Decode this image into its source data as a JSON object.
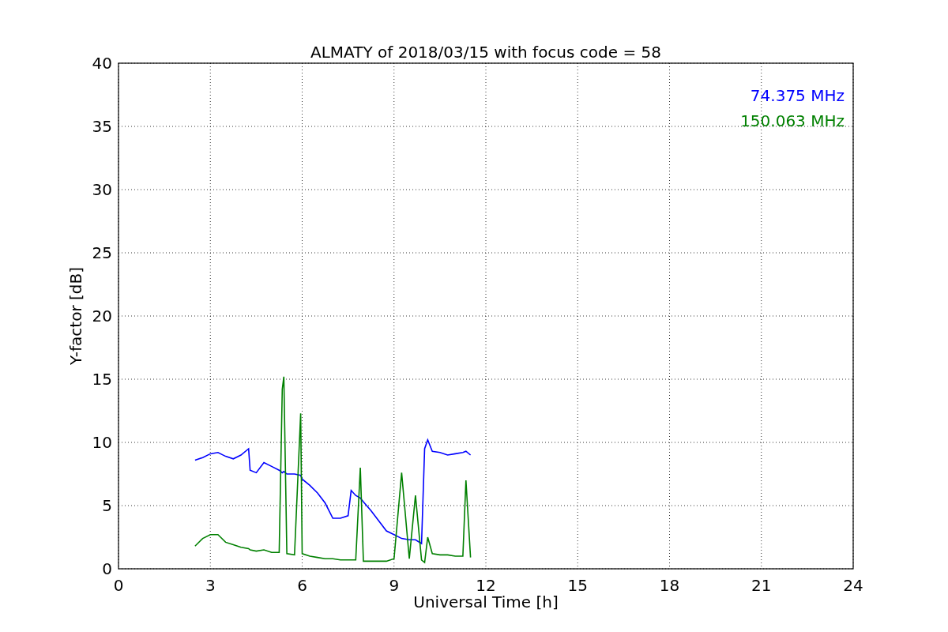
{
  "figure": {
    "chart_data": {
      "type": "line",
      "title": "ALMATY of 2018/03/15 with focus code = 58",
      "xlabel": "Universal Time [h]",
      "ylabel": "Y-factor [dB]",
      "xlim": [
        0,
        24
      ],
      "ylim": [
        0,
        40
      ],
      "xticks": [
        0,
        3,
        6,
        9,
        12,
        15,
        18,
        21,
        24
      ],
      "yticks": [
        0,
        5,
        10,
        15,
        20,
        25,
        30,
        35,
        40
      ],
      "grid": true,
      "x": [
        2.5,
        2.75,
        3,
        3.25,
        3.5,
        3.75,
        4,
        4.25,
        4.3,
        4.5,
        4.75,
        5,
        5.25,
        5.35,
        5.4,
        5.5,
        5.75,
        5.95,
        6,
        6.25,
        6.5,
        6.75,
        7,
        7.25,
        7.5,
        7.6,
        7.75,
        7.9,
        8,
        8.25,
        8.5,
        8.75,
        9,
        9.25,
        9.5,
        9.7,
        9.9,
        10,
        10.1,
        10.25,
        10.5,
        10.75,
        11,
        11.25,
        11.35,
        11.5
      ],
      "series": [
        {
          "name": "74.375 MHz",
          "color": "#0000ff",
          "values": [
            8.6,
            8.8,
            9.1,
            9.2,
            8.9,
            8.7,
            9.0,
            9.5,
            7.8,
            7.6,
            8.4,
            8.1,
            7.8,
            7.6,
            7.7,
            7.5,
            7.5,
            7.4,
            7.1,
            6.6,
            6.0,
            5.2,
            4.0,
            4.0,
            4.2,
            6.2,
            5.8,
            5.6,
            5.3,
            4.6,
            3.8,
            3.0,
            2.7,
            2.4,
            2.3,
            2.3,
            2.0,
            9.5,
            10.2,
            9.3,
            9.2,
            9.0,
            9.1,
            9.2,
            9.3,
            9.0
          ]
        },
        {
          "name": "150.063 MHz",
          "color": "#008000",
          "values": [
            1.8,
            2.4,
            2.7,
            2.7,
            2.1,
            1.9,
            1.7,
            1.6,
            1.5,
            1.4,
            1.5,
            1.3,
            1.3,
            14.2,
            15.2,
            1.2,
            1.1,
            12.3,
            1.2,
            1.0,
            0.9,
            0.8,
            0.8,
            0.7,
            0.7,
            0.7,
            0.7,
            8.0,
            0.6,
            0.6,
            0.6,
            0.6,
            0.8,
            7.6,
            0.8,
            5.8,
            0.7,
            0.5,
            2.5,
            1.2,
            1.1,
            1.1,
            1.0,
            1.0,
            7.0,
            0.9
          ]
        }
      ]
    }
  }
}
